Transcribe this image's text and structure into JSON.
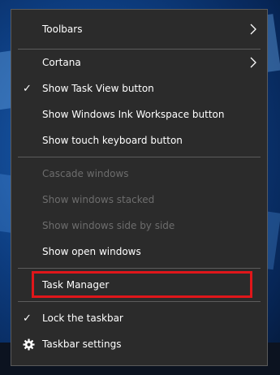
{
  "menu": {
    "items": [
      {
        "label": "Toolbars"
      },
      {
        "label": "Cortana"
      },
      {
        "label": "Show Task View button"
      },
      {
        "label": "Show Windows Ink Workspace button"
      },
      {
        "label": "Show touch keyboard button"
      },
      {
        "label": "Cascade windows"
      },
      {
        "label": "Show windows stacked"
      },
      {
        "label": "Show windows side by side"
      },
      {
        "label": "Show open windows"
      },
      {
        "label": "Task Manager"
      },
      {
        "label": "Lock the taskbar"
      },
      {
        "label": "Taskbar settings"
      }
    ],
    "checkmark": "✓",
    "highlight_color": "#e0161a"
  }
}
